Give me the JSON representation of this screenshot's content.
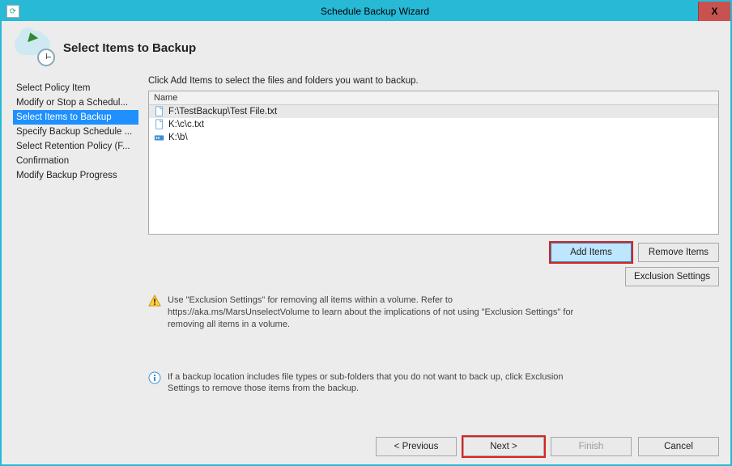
{
  "window": {
    "title": "Schedule Backup Wizard",
    "close": "X"
  },
  "page": {
    "title": "Select Items to Backup"
  },
  "sidebar": {
    "items": [
      {
        "label": "Select Policy Item"
      },
      {
        "label": "Modify or Stop a Schedul..."
      },
      {
        "label": "Select Items to Backup"
      },
      {
        "label": "Specify Backup Schedule ..."
      },
      {
        "label": "Select Retention Policy (F..."
      },
      {
        "label": "Confirmation"
      },
      {
        "label": "Modify Backup Progress"
      }
    ],
    "selected_index": 2
  },
  "main": {
    "instruction": "Click Add Items to select the files and folders you want to backup.",
    "grid": {
      "header": "Name",
      "rows": [
        {
          "type": "file",
          "label": "F:\\TestBackup\\Test File.txt"
        },
        {
          "type": "file",
          "label": "K:\\c\\c.txt"
        },
        {
          "type": "folder",
          "label": "K:\\b\\"
        }
      ],
      "selected_index": 0
    },
    "buttons": {
      "add_items": "Add Items",
      "remove_items": "Remove Items",
      "exclusion_settings": "Exclusion Settings"
    },
    "warning_text": "Use \"Exclusion Settings\" for removing all items within a volume. Refer to https://aka.ms/MarsUnselectVolume to learn about the implications of not using \"Exclusion Settings\" for removing all items in a volume.",
    "info_text": "If a backup location includes file types or sub-folders that you do not want to back up, click Exclusion Settings to remove those items from the backup."
  },
  "footer": {
    "previous": "< Previous",
    "next": "Next >",
    "finish": "Finish",
    "cancel": "Cancel"
  }
}
